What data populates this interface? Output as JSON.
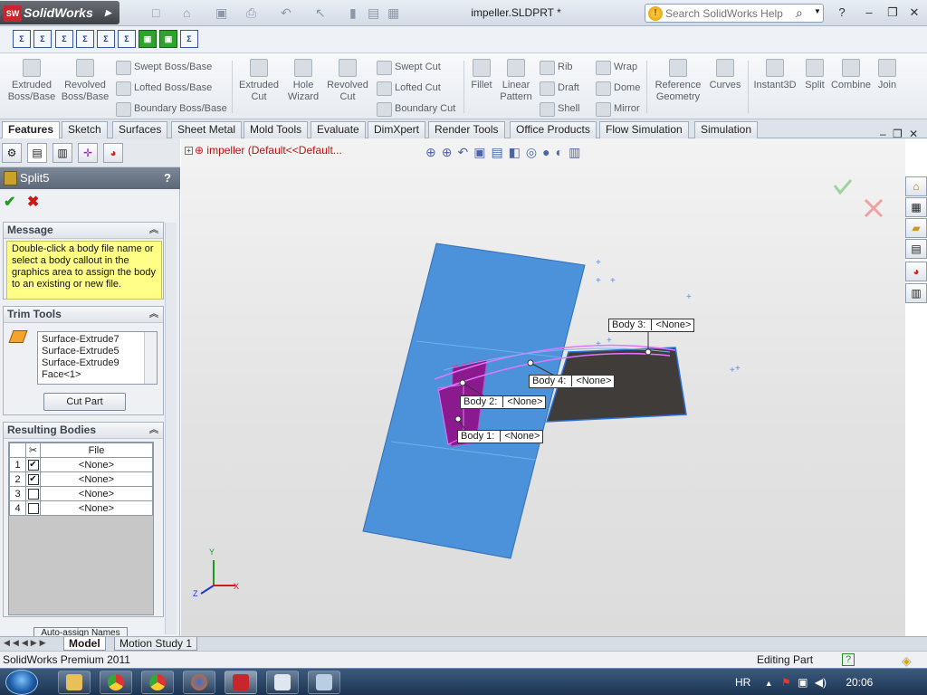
{
  "app": {
    "logo_text": "SolidWorks",
    "logo_badge": "SW",
    "document_title": "impeller.SLDPRT *"
  },
  "search": {
    "placeholder": "Search SolidWorks Help"
  },
  "sketch_tools": [
    "Σ",
    "Σ",
    "Σ",
    "Σ",
    "Σ",
    "Σ",
    "▣",
    "▣",
    "Σ"
  ],
  "command_manager": {
    "extruded_boss": "Extruded\nBoss/Base",
    "revolved_boss": "Revolved\nBoss/Base",
    "swept_boss": "Swept Boss/Base",
    "lofted_boss": "Lofted Boss/Base",
    "boundary_boss": "Boundary Boss/Base",
    "extruded_cut": "Extruded\nCut",
    "hole_wizard": "Hole\nWizard",
    "revolved_cut": "Revolved\nCut",
    "swept_cut": "Swept Cut",
    "lofted_cut": "Lofted Cut",
    "boundary_cut": "Boundary Cut",
    "fillet": "Fillet",
    "linear_pattern": "Linear\nPattern",
    "rib": "Rib",
    "draft": "Draft",
    "shell": "Shell",
    "wrap": "Wrap",
    "dome": "Dome",
    "mirror": "Mirror",
    "reference_geometry": "Reference\nGeometry",
    "curves": "Curves",
    "instant3d": "Instant3D",
    "split": "Split",
    "combine": "Combine",
    "join": "Join"
  },
  "tabs": [
    "Features",
    "Sketch",
    "Surfaces",
    "Sheet Metal",
    "Mold Tools",
    "Evaluate",
    "DimXpert",
    "Render Tools",
    "Office Products",
    "Flow Simulation",
    "Simulation"
  ],
  "property_manager": {
    "title": "Split5",
    "help": "?",
    "message_header": "Message",
    "message": "Double-click a body file name or select a body callout in the graphics area to assign the body to an existing or new file.",
    "trim_header": "Trim Tools",
    "trim_items": [
      "Surface-Extrude7",
      "Surface-Extrude5",
      "Surface-Extrude9",
      "Face<1>"
    ],
    "cut_part": "Cut Part",
    "bodies_header": "Resulting Bodies",
    "file_col": "File",
    "bodies": [
      {
        "n": "1",
        "checked": true,
        "file": "<None>"
      },
      {
        "n": "2",
        "checked": true,
        "file": "<None>"
      },
      {
        "n": "3",
        "checked": false,
        "file": "<None>"
      },
      {
        "n": "4",
        "checked": false,
        "file": "<None>"
      }
    ],
    "auto_assign": "Auto-assign Names"
  },
  "graphics": {
    "tree_root": "impeller  (Default<<Default...",
    "callouts": [
      {
        "label": "Body  3:",
        "file": "<None>"
      },
      {
        "label": "Body  4:",
        "file": "<None>"
      },
      {
        "label": "Body  2:",
        "file": "<None>"
      },
      {
        "label": "Body  1:",
        "file": "<None>"
      }
    ],
    "axes": {
      "x": "X",
      "y": "Y",
      "z": "Z"
    },
    "colors": {
      "surface": "#4b92db",
      "dark_body": "#3f3c39",
      "purple_body": "#8b1a8e",
      "edge_highlight": "#e276ff"
    }
  },
  "bottom_tabs": [
    "Model",
    "Motion Study 1"
  ],
  "status": {
    "product": "SolidWorks Premium 2011",
    "mode": "Editing Part"
  },
  "taskbar": {
    "language": "HR",
    "time": "20:06"
  }
}
